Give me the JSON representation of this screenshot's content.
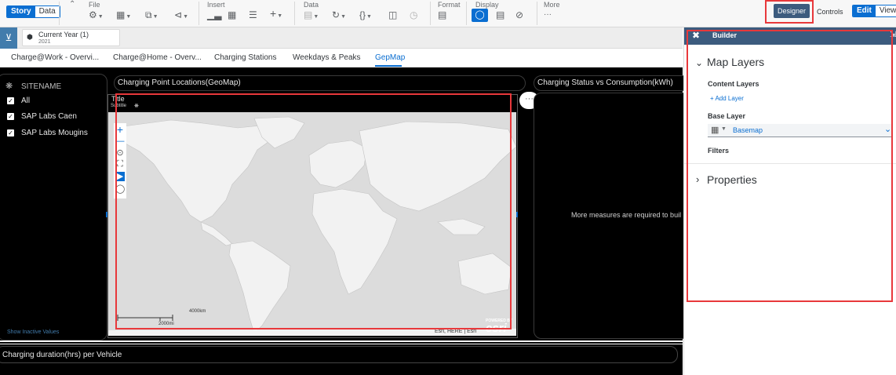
{
  "toolbar": {
    "story_label": "Story",
    "data_label": "Data",
    "groups": {
      "file": "File",
      "insert": "Insert",
      "data": "Data",
      "format": "Format",
      "display": "Display",
      "more": "More"
    },
    "more_dots": "···",
    "designer_label": "Designer",
    "controls_label": "Controls",
    "edit_label": "Edit",
    "view_label": "View"
  },
  "filter": {
    "token_title": "Current Year (1)",
    "token_value": "2021"
  },
  "tabs": [
    {
      "label": "Charge@Work - Overvi..."
    },
    {
      "label": "Charge@Home - Overv..."
    },
    {
      "label": "Charging Stations"
    },
    {
      "label": "Weekdays & Peaks"
    },
    {
      "label": "GepMap"
    }
  ],
  "sitename": {
    "header": "SITENAME",
    "options": [
      {
        "label": "All",
        "checked": true
      },
      {
        "label": "SAP Labs Caen",
        "checked": true
      },
      {
        "label": "SAP Labs Mougins",
        "checked": true
      }
    ],
    "show_inactive": "Show Inactive Values"
  },
  "geomap": {
    "header": "Charging Point Locations(GeoMap)",
    "title": "Title",
    "subtitle": "Subtitle",
    "scale_km": "4000km",
    "scale_mi": "2000mi",
    "attribution": "Esri, HERE | Esri",
    "powered_by": "POWERED BY",
    "esri_logo": "esri",
    "more_dots": "···"
  },
  "status_chart": {
    "header": "Charging Status vs Consumption(kWh)",
    "message": "More measures are required to buil"
  },
  "duration_chart": {
    "header": "Charging duration(hrs) per Vehicle"
  },
  "builder": {
    "head_title": "Builder",
    "map_layers": "Map Layers",
    "content_layers": "Content Layers",
    "add_layer": "+ Add Layer",
    "base_layer": "Base Layer",
    "basemap": "Basemap",
    "filters": "Filters",
    "properties": "Properties"
  },
  "colors": {
    "accent": "#0a6ed1",
    "builder_header": "#3c5b7e",
    "highlight": "#e8383b",
    "canvas": "#000000",
    "map_land": "#f2f2f2",
    "map_water": "#dcdcdc"
  }
}
